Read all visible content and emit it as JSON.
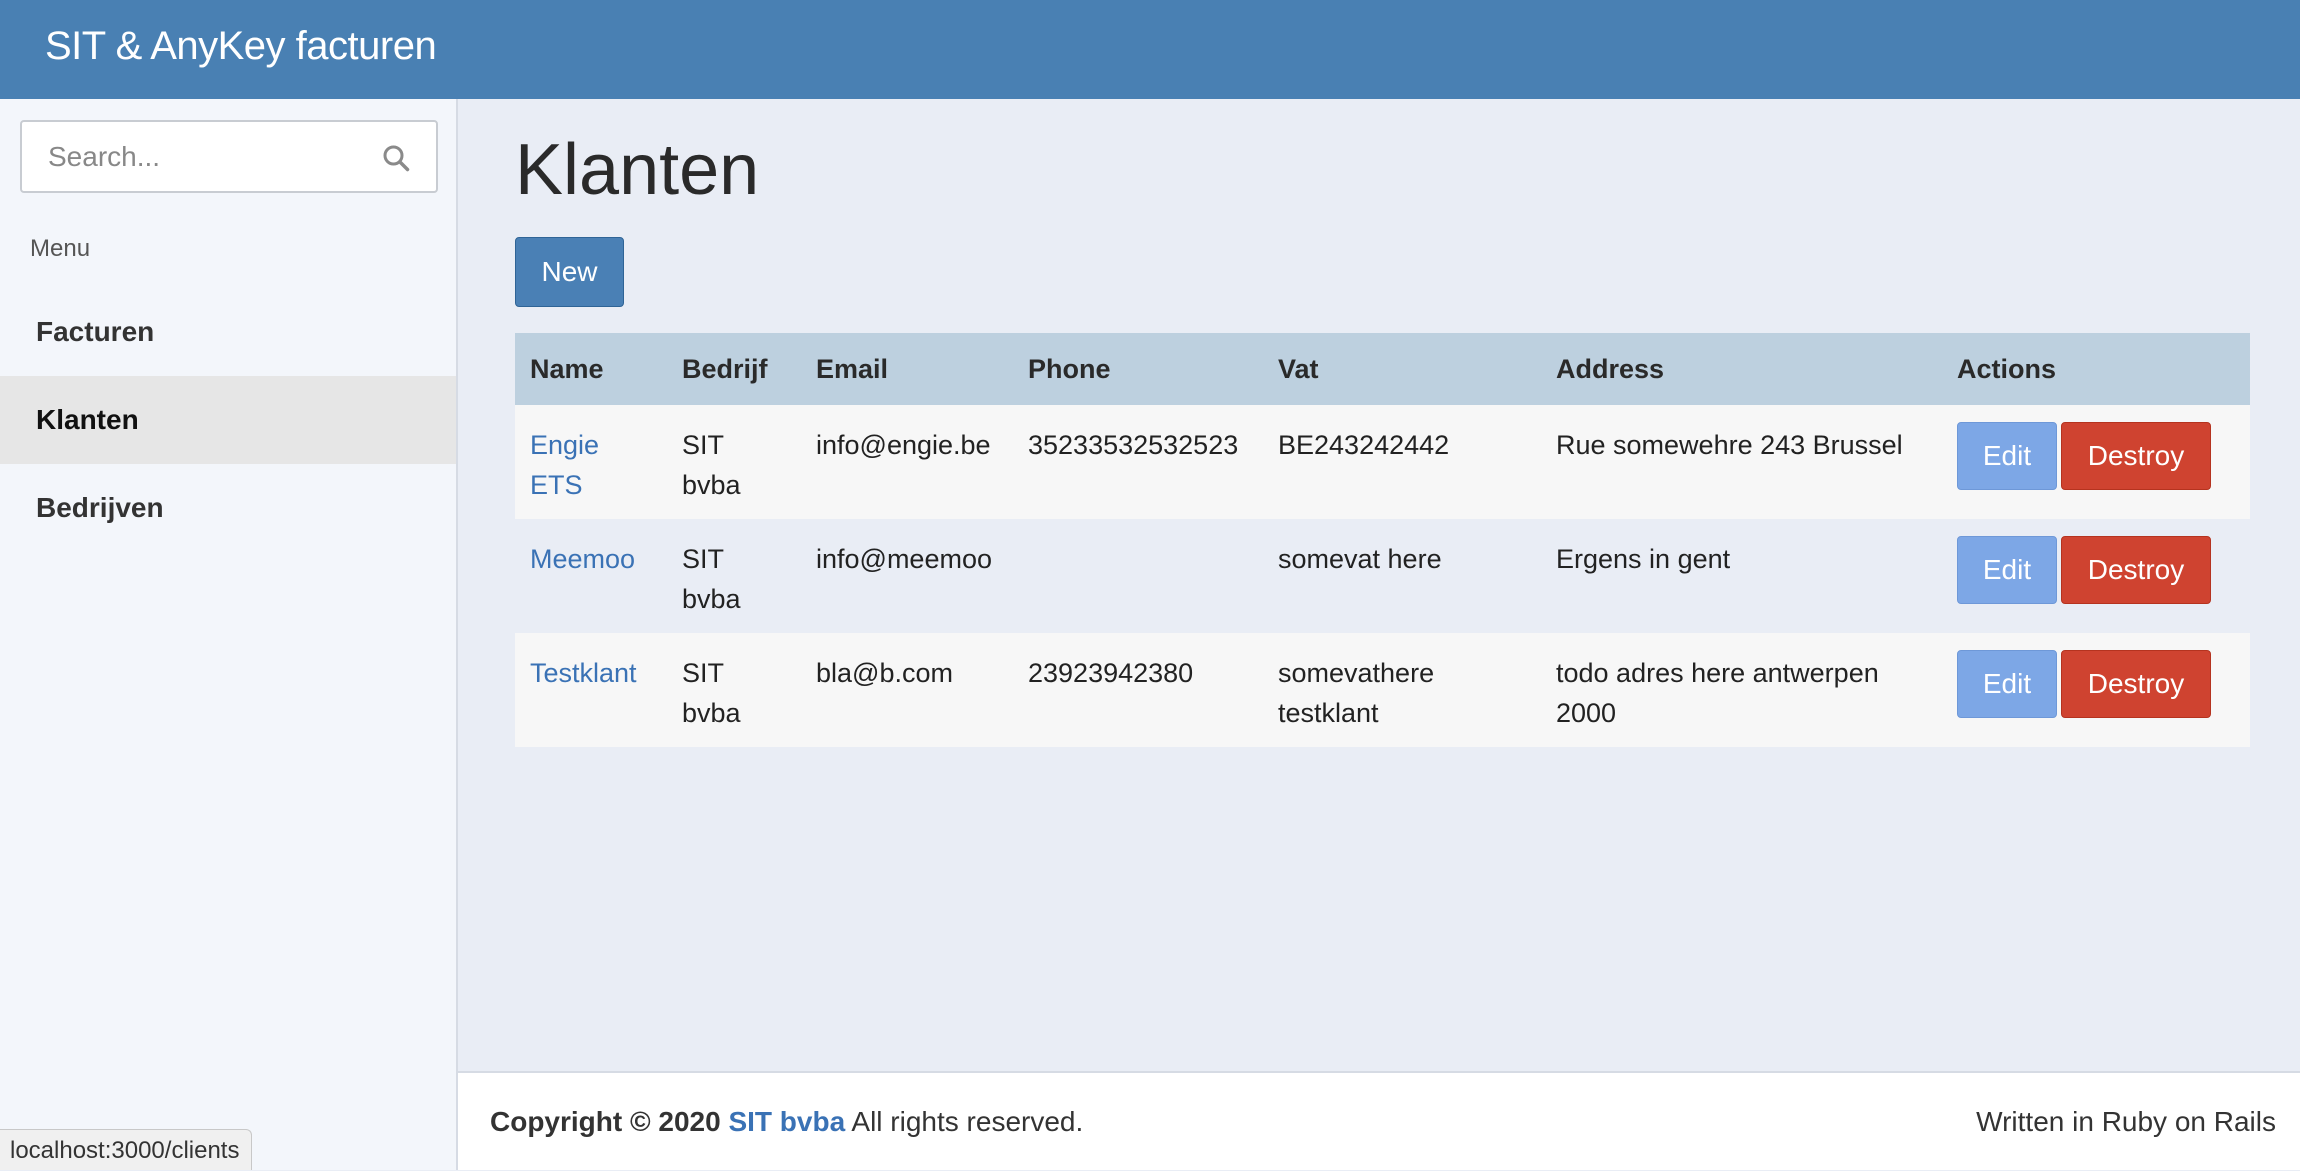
{
  "app": {
    "title": "SIT & AnyKey facturen"
  },
  "search": {
    "placeholder": "Search..."
  },
  "sidebar": {
    "menu_header": "Menu",
    "items": [
      {
        "label": "Facturen",
        "active": false
      },
      {
        "label": "Klanten",
        "active": true
      },
      {
        "label": "Bedrijven",
        "active": false
      }
    ]
  },
  "main": {
    "title": "Klanten",
    "new_label": "New"
  },
  "table": {
    "columns": [
      "Name",
      "Bedrijf",
      "Email",
      "Phone",
      "Vat",
      "Address",
      "Actions"
    ],
    "rows": [
      {
        "name": "Engie ETS",
        "bedrijf": "SIT bvba",
        "email": "info@engie.be",
        "phone": "35233532532523",
        "vat": "BE243242442",
        "address": "Rue somewehre 243 Brussel",
        "edit_label": "Edit",
        "destroy_label": "Destroy"
      },
      {
        "name": "Meemoo",
        "bedrijf": "SIT bvba",
        "email": "info@meemoo",
        "phone": "",
        "vat": "somevat here",
        "address": "Ergens in gent",
        "edit_label": "Edit",
        "destroy_label": "Destroy"
      },
      {
        "name": "Testklant",
        "bedrijf": "SIT bvba",
        "email": "bla@b.com",
        "phone": "23923942380",
        "vat": "somevathere testklant",
        "address": "todo adres here antwerpen 2000",
        "edit_label": "Edit",
        "destroy_label": "Destroy"
      }
    ]
  },
  "footer": {
    "copyright": "Copyright © 2020",
    "company_link": "SIT bvba",
    "rights": "All rights reserved.",
    "written_in": "Written in Ruby on Rails"
  },
  "status_bar": {
    "url": "localhost:3000/clients"
  },
  "colors": {
    "topbar": "#4980b3",
    "link": "#3a72b5",
    "edit": "#7da7e6",
    "destroy": "#cf4330",
    "table_header": "#bdd0df"
  },
  "icons": {
    "search": "search-icon"
  }
}
